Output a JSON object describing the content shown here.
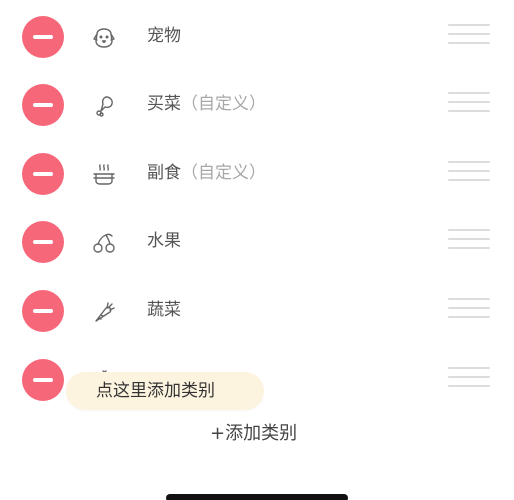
{
  "categories": [
    {
      "label": "宠物",
      "suffix": "",
      "icon": "dog-face-icon"
    },
    {
      "label": "买菜",
      "suffix": "（自定义）",
      "icon": "drumstick-icon"
    },
    {
      "label": "副食",
      "suffix": "（自定义）",
      "icon": "steaming-bowl-icon"
    },
    {
      "label": "水果",
      "suffix": "",
      "icon": "cherries-icon"
    },
    {
      "label": "蔬菜",
      "suffix": "",
      "icon": "carrot-icon"
    },
    {
      "label": "",
      "suffix": "",
      "icon": "partially-hidden-icon"
    }
  ],
  "tooltip": {
    "text": "点这里添加类别"
  },
  "actions": {
    "add_category": "+添加类别"
  },
  "colors": {
    "remove_button": "#f7677a",
    "tooltip_bg": "#fdf4e0",
    "drag_handle": "#dcdcdc",
    "label_text": "#555555",
    "suffix_text": "#a8a8a8"
  }
}
